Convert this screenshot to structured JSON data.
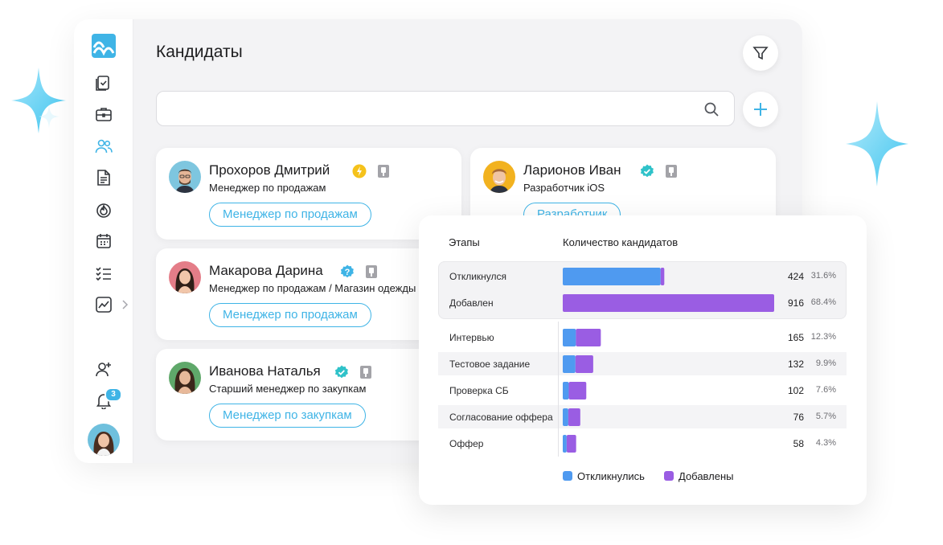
{
  "page_title": "Кандидаты",
  "search": {
    "placeholder": "",
    "value": ""
  },
  "notifications_count": "3",
  "colors": {
    "accent": "#3fb4e6",
    "responded": "#4f9af0",
    "added": "#9a5de3",
    "verified": "#2fc2c9",
    "pending": "#f5c21b"
  },
  "sidebar": {
    "items": [
      {
        "icon": "checklist-doc-icon"
      },
      {
        "icon": "briefcase-icon"
      },
      {
        "icon": "users-icon"
      },
      {
        "icon": "document-icon"
      },
      {
        "icon": "flame-icon"
      },
      {
        "icon": "calendar-icon"
      },
      {
        "icon": "tasks-list-icon"
      },
      {
        "icon": "analytics-icon"
      },
      {
        "icon": "add-user-icon"
      },
      {
        "icon": "bell-icon"
      }
    ]
  },
  "candidates": [
    {
      "name": "Прохоров Дмитрий",
      "role": "Менеджер по продажам",
      "tag": "Менеджер по продажам",
      "status": "pending"
    },
    {
      "name": "Макарова Дарина",
      "role": "Менеджер по продажам / Магазин одежды",
      "tag": "Менеджер по продажам",
      "status": "question"
    },
    {
      "name": "Иванова Наталья",
      "role": "Старший менеджер по закупкам",
      "tag": "Менеджер по закупкам",
      "status": "verified"
    },
    {
      "name": "Ларионов  Иван",
      "role": "Разработчик iOS",
      "tag": "Разработчик",
      "status": "verified"
    }
  ],
  "chart_data": {
    "type": "bar",
    "orientation": "horizontal",
    "stacked": true,
    "headers": {
      "stage": "Этапы",
      "count": "Количество кандидатов"
    },
    "categories": [
      "Откликнулся",
      "Добавлен",
      "Интервью",
      "Тестовое задание",
      "Проверка СБ",
      "Согласование оффера",
      "Оффер"
    ],
    "counts": [
      "424",
      "916",
      "165",
      "132",
      "102",
      "76",
      "58"
    ],
    "percents": [
      "31.6%",
      "68.4%",
      "12.3%",
      "9.9%",
      "7.6%",
      "5.7%",
      "4.3%"
    ],
    "series": [
      {
        "name": "Откликнулись",
        "values": [
          424,
          0,
          57,
          55,
          26,
          24,
          17
        ]
      },
      {
        "name": "Добавлены",
        "values": [
          16,
          916,
          108,
          77,
          76,
          52,
          41
        ]
      }
    ],
    "legend": [
      "Откликнулись",
      "Добавлены"
    ],
    "xlim": [
      0,
      916
    ],
    "legend_position": "bottom"
  }
}
